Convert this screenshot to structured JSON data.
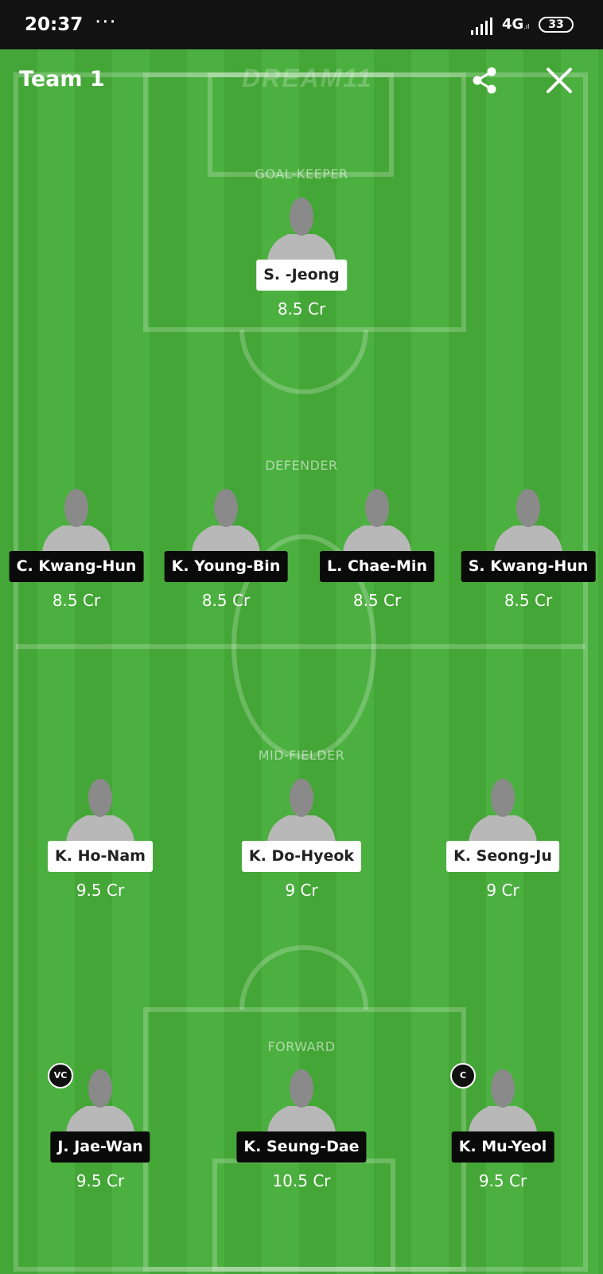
{
  "status_bar": {
    "time": "20:37",
    "dots": "···",
    "network": "4G",
    "battery": "33"
  },
  "header": {
    "title": "Team 1",
    "brand": "DREAM11"
  },
  "colors": {
    "pitch_green": "#44a636",
    "pitch_green_alt": "#4cb040",
    "card_dark": "#0a0a0a"
  },
  "sections": {
    "goalkeeper": {
      "label": "GOAL-KEEPER",
      "players": [
        {
          "name": "S. -Jeong",
          "credits": "8.5 Cr",
          "style": "light"
        }
      ]
    },
    "defender": {
      "label": "DEFENDER",
      "players": [
        {
          "name": "C. Kwang-Hun",
          "credits": "8.5 Cr",
          "style": "dark"
        },
        {
          "name": "K. Young-Bin",
          "credits": "8.5 Cr",
          "style": "dark"
        },
        {
          "name": "L. Chae-Min",
          "credits": "8.5 Cr",
          "style": "dark"
        },
        {
          "name": "S. Kwang-Hun",
          "credits": "8.5 Cr",
          "style": "dark"
        }
      ]
    },
    "midfielder": {
      "label": "MID-FIELDER",
      "players": [
        {
          "name": "K. Ho-Nam",
          "credits": "9.5 Cr",
          "style": "light"
        },
        {
          "name": "K. Do-Hyeok",
          "credits": "9 Cr",
          "style": "light"
        },
        {
          "name": "K. Seong-Ju",
          "credits": "9 Cr",
          "style": "light"
        }
      ]
    },
    "forward": {
      "label": "FORWARD",
      "players": [
        {
          "name": "J. Jae-Wan",
          "credits": "9.5 Cr",
          "style": "dark",
          "badge": "VC"
        },
        {
          "name": "K. Seung-Dae",
          "credits": "10.5 Cr",
          "style": "dark"
        },
        {
          "name": "K. Mu-Yeol",
          "credits": "9.5 Cr",
          "style": "dark",
          "badge": "C"
        }
      ]
    }
  }
}
